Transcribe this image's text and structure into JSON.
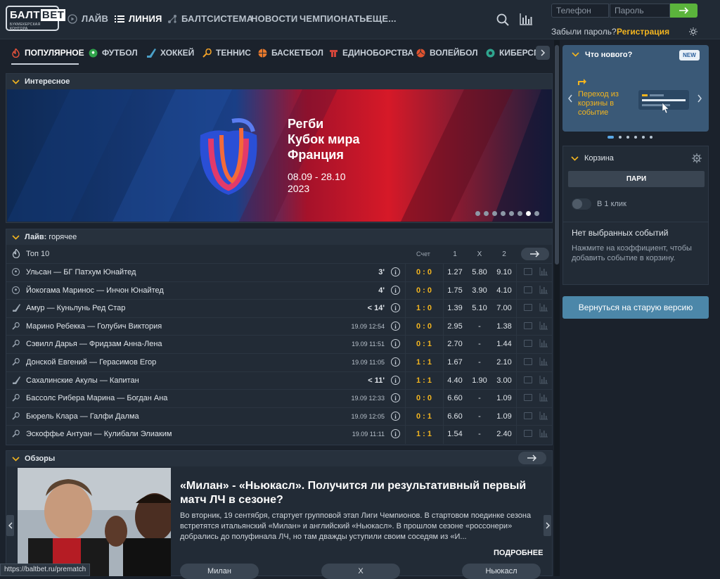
{
  "header": {
    "logo_top": "БАЛТ",
    "logo_bet": "BET",
    "logo_sub": "БУКМЕКЕРСКАЯ КОНТОРА",
    "nav": [
      {
        "label": "ЛАЙВ"
      },
      {
        "label": "ЛИНИЯ"
      },
      {
        "label": "БАЛТСИСТЕМА"
      },
      {
        "label": "НОВОСТИ"
      },
      {
        "label": "ЧЕМПИОНАТЫ"
      },
      {
        "label": "ЕЩЕ..."
      }
    ],
    "phone_placeholder": "Телефон",
    "password_placeholder": "Пароль",
    "forgot": "Забыли пароль?",
    "register": "Регистрация"
  },
  "sport_tabs": [
    "ПОПУЛЯРНОЕ",
    "ФУТБОЛ",
    "ХОККЕЙ",
    "ТЕННИС",
    "БАСКЕТБОЛ",
    "ЕДИНОБОРСТВА",
    "ВОЛЕЙБОЛ",
    "КИБЕРСПО"
  ],
  "interesting": {
    "title": "Интересное",
    "banner_line1": "Регби",
    "banner_line2": "Кубок мира",
    "banner_line3": "Франция",
    "banner_dates": "08.09 - 28.10",
    "banner_year": "2023",
    "dots": 8,
    "active_dot": 6
  },
  "live": {
    "title": "Лайв:",
    "subtitle": "горячее",
    "top10": "Топ 10",
    "col_score": "Счет",
    "col_1": "1",
    "col_x": "X",
    "col_2": "2",
    "rows": [
      {
        "icon": "soccer-icon",
        "match": "Ульсан — БГ Патхум Юнайтед",
        "time": "3'",
        "score": "0 : 0",
        "o1": "1.27",
        "ox": "5.80",
        "o2": "9.10"
      },
      {
        "icon": "soccer-icon",
        "match": "Йокогама Маринос — Инчон Юнайтед",
        "time": "4'",
        "score": "0 : 0",
        "o1": "1.75",
        "ox": "3.90",
        "o2": "4.10"
      },
      {
        "icon": "hockey-icon",
        "match": "Амур — Куньлунь Ред Стар",
        "time": "< 14'",
        "score": "1 : 0",
        "o1": "1.39",
        "ox": "5.10",
        "o2": "7.00"
      },
      {
        "icon": "tennis-icon",
        "match": "Марино Ребекка — Голубич Виктория",
        "time": "19.09 12:54",
        "score": "0 : 0",
        "o1": "2.95",
        "ox": "-",
        "o2": "1.38"
      },
      {
        "icon": "tennis-icon",
        "match": "Сэвилл Дарья — Фридзам Анна-Лена",
        "time": "19.09 11:51",
        "score": "0 : 1",
        "o1": "2.70",
        "ox": "-",
        "o2": "1.44"
      },
      {
        "icon": "tennis-icon",
        "match": "Донской Евгений — Герасимов Егор",
        "time": "19.09 11:05",
        "score": "1 : 1",
        "o1": "1.67",
        "ox": "-",
        "o2": "2.10"
      },
      {
        "icon": "hockey-icon",
        "match": "Сахалинские Акулы — Капитан",
        "time": "< 11'",
        "score": "1 : 1",
        "o1": "4.40",
        "ox": "1.90",
        "o2": "3.00"
      },
      {
        "icon": "tennis-icon",
        "match": "Бассолс Рибера Марина — Богдан Ана",
        "time": "19.09 12:33",
        "score": "0 : 0",
        "o1": "6.60",
        "ox": "-",
        "o2": "1.09"
      },
      {
        "icon": "tennis-icon",
        "match": "Бюрель Клара — Галфи Далма",
        "time": "19.09 12:05",
        "score": "0 : 1",
        "o1": "6.60",
        "ox": "-",
        "o2": "1.09"
      },
      {
        "icon": "tennis-icon",
        "match": "Эскоффье Антуан — Кулибали Элиаким",
        "time": "19.09 11:11",
        "score": "1 : 1",
        "o1": "1.54",
        "ox": "-",
        "o2": "2.40"
      }
    ]
  },
  "reviews": {
    "title": "Обзоры",
    "headline": "«Милан» - «Ньюкасл». Получится ли результативный первый матч ЛЧ в сезоне?",
    "text": "Во вторник, 19 сентября, стартует групповой этап Лиги Чемпионов. В стартовом поединке сезона встретятся итальянский «Милан» и английский «Ньюкасл». В прошлом сезоне «россонери» добрались до полуфинала ЛЧ, но там дважды уступили своим соседям из «И...",
    "more": "ПОДРОБНЕЕ",
    "bets": [
      "Милан",
      "X",
      "Ньюкасл"
    ]
  },
  "whatsnew": {
    "title": "Что нового?",
    "badge": "NEW",
    "text": "Переход из корзины в событие",
    "dots": 6,
    "active_dot": 0
  },
  "cart": {
    "title": "Корзина",
    "tab": "ПАРИ",
    "one_click": "В 1 клик",
    "empty_title": "Нет выбранных событий",
    "empty_text": "Нажмите на коэффициент, чтобы добавить событие в корзину."
  },
  "old_version": "Вернуться на старую версию",
  "status_url": "https://baltbet.ru/prematch",
  "colors": {
    "accent": "#f3b51f",
    "green": "#5bb43c",
    "bg": "#1b222c"
  }
}
